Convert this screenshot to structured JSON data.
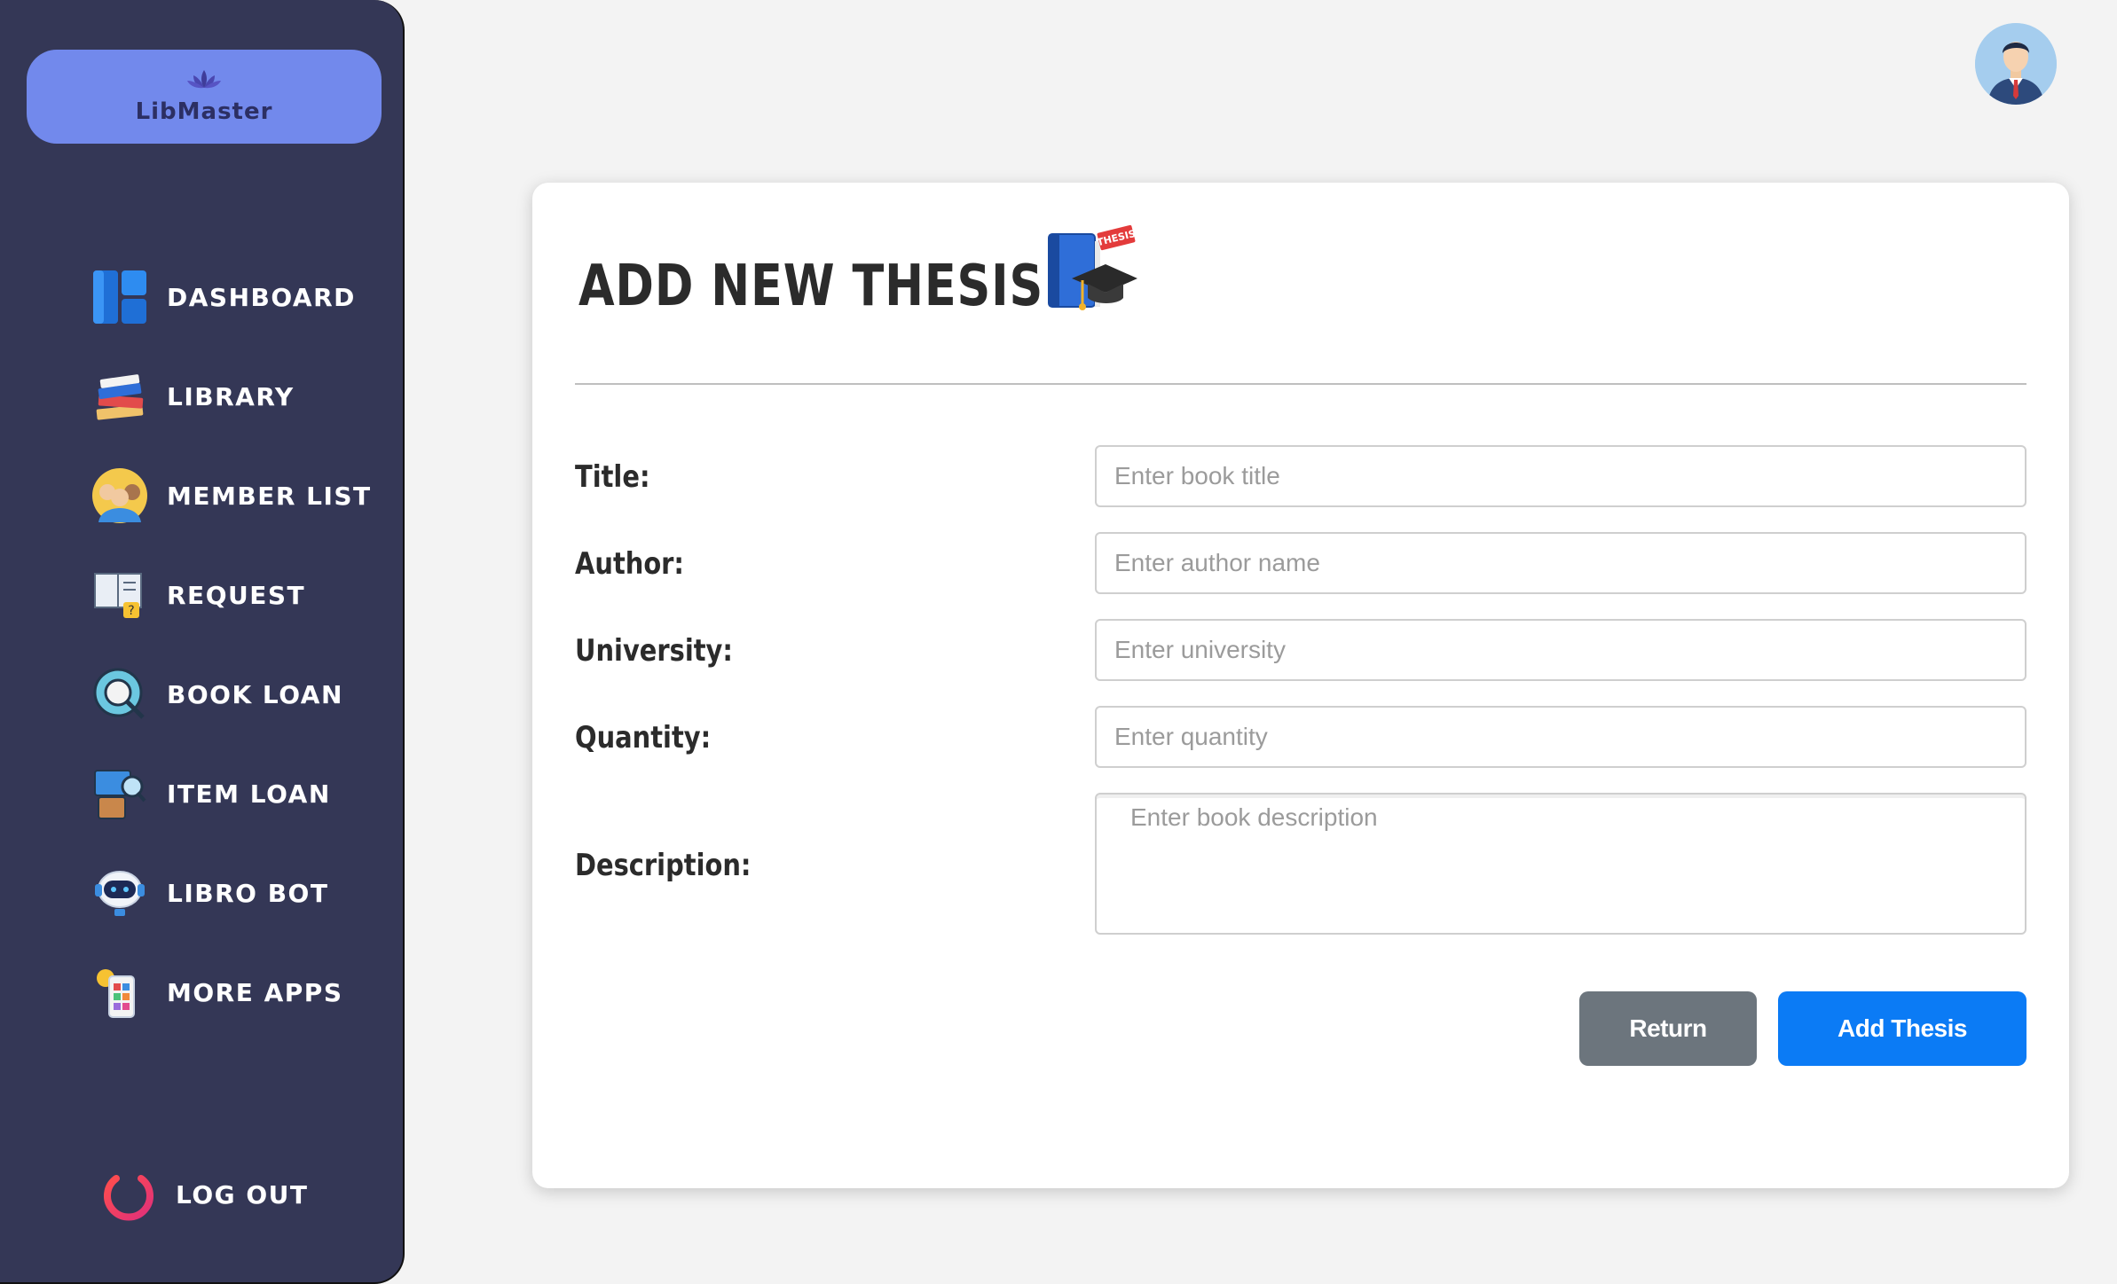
{
  "app": {
    "name": "LibMaster"
  },
  "sidebar": {
    "items": [
      {
        "label": "DASHBOARD",
        "icon": "dashboard-icon"
      },
      {
        "label": "LIBRARY",
        "icon": "books-icon"
      },
      {
        "label": "MEMBER LIST",
        "icon": "members-icon"
      },
      {
        "label": "REQUEST",
        "icon": "request-icon"
      },
      {
        "label": "BOOK LOAN",
        "icon": "book-loan-icon"
      },
      {
        "label": "ITEM LOAN",
        "icon": "item-loan-icon"
      },
      {
        "label": "LIBRO BOT",
        "icon": "robot-icon"
      },
      {
        "label": "MORE APPS",
        "icon": "more-apps-icon"
      }
    ],
    "logout": {
      "label": "LOG OUT",
      "icon": "power-icon"
    }
  },
  "form": {
    "title": "ADD NEW THESIS",
    "title_icon": "thesis-book-graduation-cap-icon",
    "title_icon_tag": "THESIS",
    "fields": {
      "title": {
        "label": "Title:",
        "placeholder": "Enter book title",
        "value": ""
      },
      "author": {
        "label": "Author:",
        "placeholder": "Enter author name",
        "value": ""
      },
      "university": {
        "label": "University:",
        "placeholder": "Enter university",
        "value": ""
      },
      "quantity": {
        "label": "Quantity:",
        "placeholder": "Enter quantity",
        "value": ""
      },
      "description": {
        "label": "Description:",
        "placeholder": "Enter book description",
        "value": ""
      }
    },
    "buttons": {
      "return_label": "Return",
      "add_label": "Add Thesis"
    }
  },
  "colors": {
    "sidebar_bg": "#343756",
    "logo_pill": "#7289ec",
    "primary": "#0b7bf5",
    "secondary": "#6c757d",
    "page_bg": "#f3f3f3"
  }
}
